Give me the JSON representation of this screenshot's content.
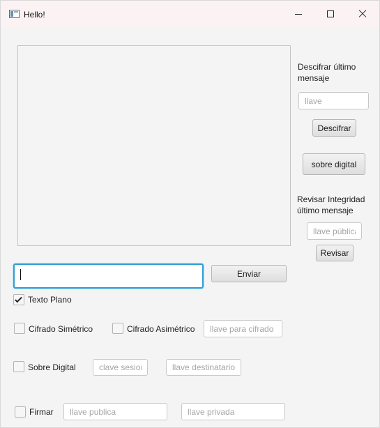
{
  "window": {
    "title": "Hello!"
  },
  "sidebar": {
    "decrypt_label": "Descifrar último mensaje",
    "key_placeholder": "llave",
    "decrypt_button": "Descifrar",
    "envelope_button": "sobre digital",
    "integrity_label": "Revisar Integridad último mensaje",
    "public_key_placeholder": "llave pública",
    "check_button": "Revisar"
  },
  "compose": {
    "message_value": "",
    "send_button": "Enviar"
  },
  "options": {
    "plain_text": {
      "label": "Texto Plano",
      "checked": true
    },
    "symmetric": {
      "label": "Cifrado Simétrico",
      "checked": false
    },
    "asymmetric": {
      "label": "Cifrado Asimétrico",
      "checked": false
    },
    "cipher_key_placeholder": "llave para cifrado",
    "digital_envelope": {
      "label": "Sobre Digital",
      "checked": false
    },
    "session_key_placeholder": "clave sesion",
    "recipient_key_placeholder": "llave destinatario",
    "sign": {
      "label": "Firmar",
      "checked": false
    },
    "sign_public_key_placeholder": "llave publica",
    "sign_private_key_placeholder": "llave privada"
  }
}
